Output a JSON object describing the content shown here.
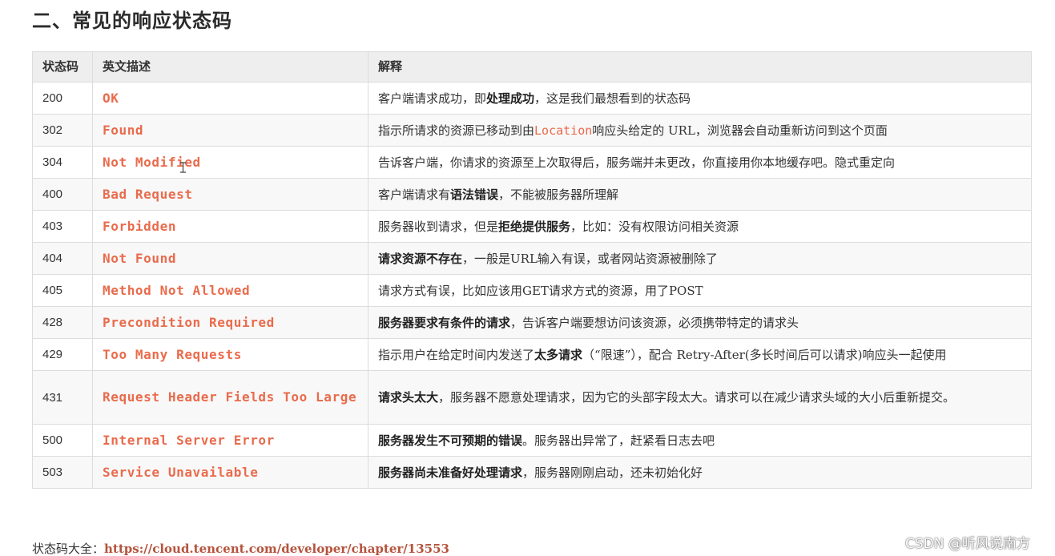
{
  "heading": "二、常见的响应状态码",
  "table": {
    "headers": {
      "code": "状态码",
      "english": "英文描述",
      "explain": "解释"
    },
    "rows": [
      {
        "code": "200",
        "english": "OK",
        "parts": [
          {
            "t": "客户端请求成功，即"
          },
          {
            "t": "处理成功",
            "b": true
          },
          {
            "t": "，这是我们最想看到的状态码"
          }
        ]
      },
      {
        "code": "302",
        "english": "Found",
        "parts": [
          {
            "t": "指示所请求的资源已移动到由"
          },
          {
            "t": "Location",
            "c": true
          },
          {
            "t": "响应头给定的 URL，浏览器会自动重新访问到这个页面"
          }
        ]
      },
      {
        "code": "304",
        "english": "Not Modified",
        "parts": [
          {
            "t": "告诉客户端，你请求的资源至上次取得后，服务端并未更改，你直接用你本地缓存吧。隐式重定向"
          }
        ]
      },
      {
        "code": "400",
        "english": "Bad Request",
        "parts": [
          {
            "t": "客户端请求有"
          },
          {
            "t": "语法错误",
            "b": true
          },
          {
            "t": "，不能被服务器所理解"
          }
        ]
      },
      {
        "code": "403",
        "english": "Forbidden",
        "parts": [
          {
            "t": "服务器收到请求，但是"
          },
          {
            "t": "拒绝提供服务",
            "b": true
          },
          {
            "t": "，比如：没有权限访问相关资源"
          }
        ]
      },
      {
        "code": "404",
        "english": "Not Found",
        "parts": [
          {
            "t": "请求资源不存在",
            "b": true
          },
          {
            "t": "，一般是URL输入有误，或者网站资源被删除了"
          }
        ]
      },
      {
        "code": "405",
        "english": "Method Not Allowed",
        "parts": [
          {
            "t": "请求方式有误，比如应该用GET请求方式的资源，用了POST"
          }
        ]
      },
      {
        "code": "428",
        "english": "Precondition Required",
        "parts": [
          {
            "t": "服务器要求有条件的请求",
            "b": true
          },
          {
            "t": "，告诉客户端要想访问该资源，必须携带特定的请求头"
          }
        ]
      },
      {
        "code": "429",
        "english": "Too Many Requests",
        "parts": [
          {
            "t": "指示用户在给定时间内发送了"
          },
          {
            "t": "太多请求",
            "b": true
          },
          {
            "t": "（“限速”），配合 Retry-After(多长时间后可以请求)响应头一起使用"
          }
        ]
      },
      {
        "code": "431",
        "english": "Request Header Fields Too Large",
        "parts": [
          {
            "t": "请求头太大",
            "b": true
          },
          {
            "t": "，服务器不愿意处理请求，因为它的头部字段太大。请求可以在减少请求头域的大小后重新提交。"
          }
        ]
      },
      {
        "code": "500",
        "english": "Internal Server Error",
        "parts": [
          {
            "t": "服务器发生不可预期的错误",
            "b": true
          },
          {
            "t": "。服务器出异常了，赶紧看日志去吧"
          }
        ]
      },
      {
        "code": "503",
        "english": "Service Unavailable",
        "parts": [
          {
            "t": "服务器尚未准备好处理请求",
            "b": true
          },
          {
            "t": "，服务器刚刚启动，还未初始化好"
          }
        ]
      }
    ]
  },
  "footer": {
    "label": "状态码大全：",
    "link_text": "https://cloud.tencent.com/developer/chapter/13553"
  },
  "watermark": "CSDN @听风说南方",
  "colors": {
    "accent": "#e96b4c",
    "link": "#b5533c",
    "header_bg": "#eeeeee",
    "border": "#dcdcdc"
  },
  "icons": {
    "cursor": "text-cursor-icon"
  }
}
